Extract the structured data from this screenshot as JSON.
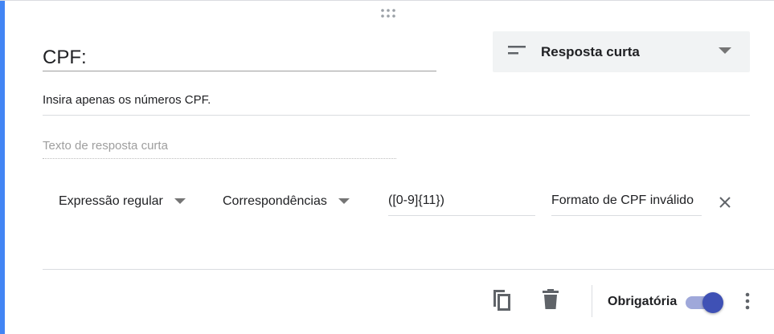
{
  "question": {
    "title": "CPF:",
    "description": "Insira apenas os números CPF.",
    "type": {
      "label": "Resposta curta",
      "icon": "short-text-icon"
    },
    "answer_placeholder": "Texto de resposta curta"
  },
  "validation": {
    "kind": "Expressão regular",
    "condition": "Correspondências",
    "pattern": "([0-9]{11})",
    "error_text": "Formato de CPF inválido"
  },
  "footer": {
    "required_label": "Obrigatória",
    "required_on": true
  },
  "colors": {
    "accent_bar": "#4285f4",
    "toggle_thumb": "#3f51b5",
    "toggle_track": "#9fa8da",
    "icon_gray": "#5f6368"
  }
}
